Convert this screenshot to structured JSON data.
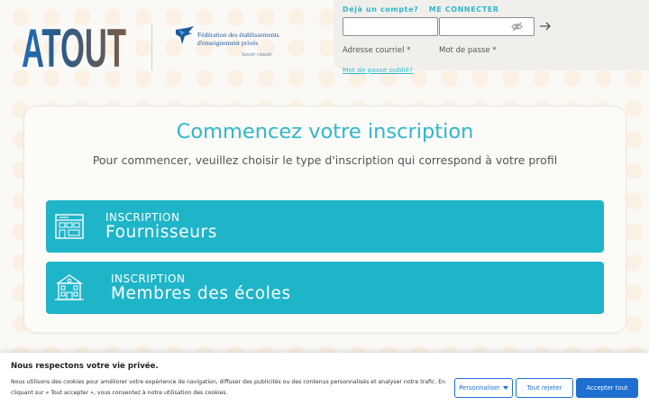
{
  "header": {
    "logo_text": "ATOUT",
    "partner_name": "Fédération des établissements d'enseignement privés",
    "partner_slogan": "Savoir réussir"
  },
  "login": {
    "already_label": "Déjà un compte?",
    "connect_label": "ME CONNECTER",
    "email_value": "",
    "password_value": "",
    "email_label": "Adresse courriel *",
    "password_label": "Mot de passe *",
    "forgot_label": "Mot de passe oublié?",
    "icons": [
      "eye-slash-icon",
      "arrow-right-icon"
    ]
  },
  "main": {
    "title": "Commencez votre inscription",
    "subtitle": "Pour commencer, veuillez choisir le type d'inscription qui correspond à votre profil",
    "options": [
      {
        "kicker": "INSCRIPTION",
        "label": "Fournisseurs",
        "icon": "building-icon"
      },
      {
        "kicker": "INSCRIPTION",
        "label": "Membres des écoles",
        "icon": "school-icon"
      }
    ]
  },
  "cookie": {
    "title": "Nous respectons votre vie privée.",
    "text": "Nous utilisons des cookies pour améliorer votre expérience de navigation, diffuser des publicités ou des contenus personnalisés et analyser notre trafic. En cliquant sur « Tout accepter », vous consentez à notre utilisation des cookies.",
    "customize_label": "Personnaliser",
    "reject_label": "Tout rejeter",
    "accept_label": "Accepter tout"
  },
  "colors": {
    "accent": "#1fb5c9",
    "title": "#2fb7cc",
    "cookie_primary": "#1f6fd1",
    "atout_blue": "#1d6fb8",
    "atout_brown": "#7a5c4a"
  }
}
